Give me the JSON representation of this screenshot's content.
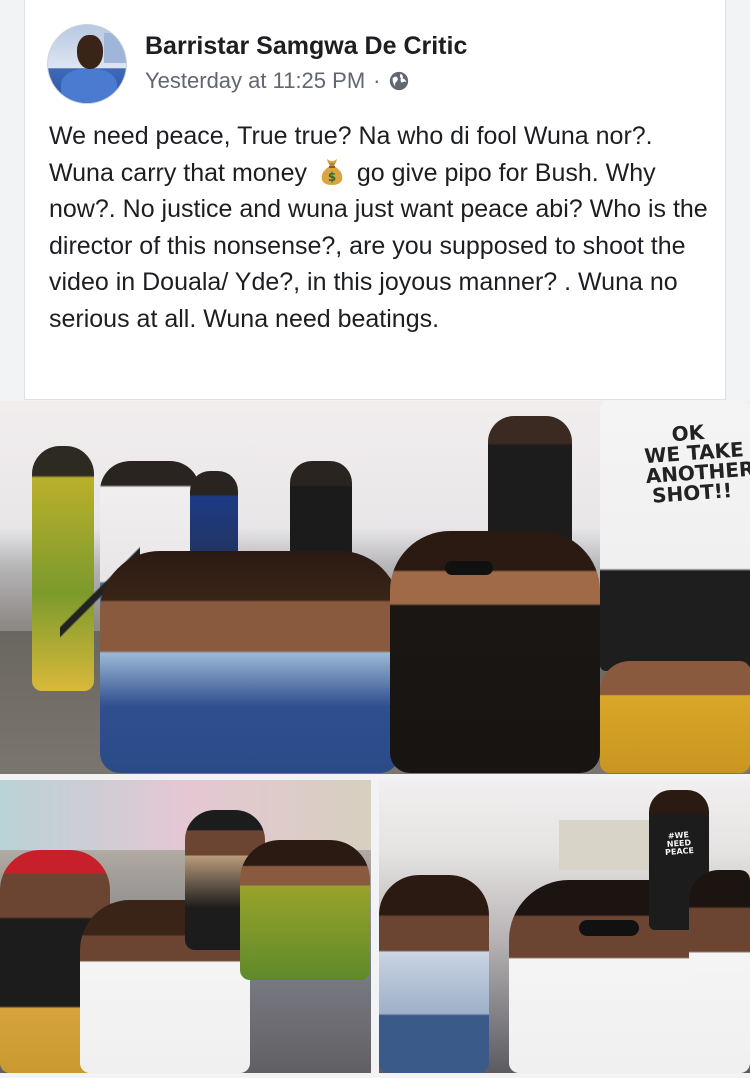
{
  "post": {
    "author": "Barristar Samgwa De Critic",
    "timestamp": "Yesterday at 11:25 PM",
    "separator": "·",
    "privacy_icon": "globe-icon",
    "text_part1": "We need peace,  True true? Na who di fool Wuna nor?. Wuna carry that money",
    "emoji_icon": "money-bag-icon",
    "text_part2": " go give pipo for Bush. Why now?. No justice and wuna just want peace abi? Who is the director of this nonsense?, are you supposed to shoot the video in Douala/ Yde?, in this joyous manner? . Wuna no serious at all. Wuna need beatings."
  },
  "photos": {
    "main_shirt_text": "OK\nWE TAKE\nANOTHER\nSHOT!!",
    "right_shirt_text": "#WE\nNEED\nPEACE"
  },
  "colors": {
    "card_bg": "#ffffff",
    "page_bg": "#f2f3f5",
    "text": "#1c1e21",
    "meta": "#606770"
  }
}
